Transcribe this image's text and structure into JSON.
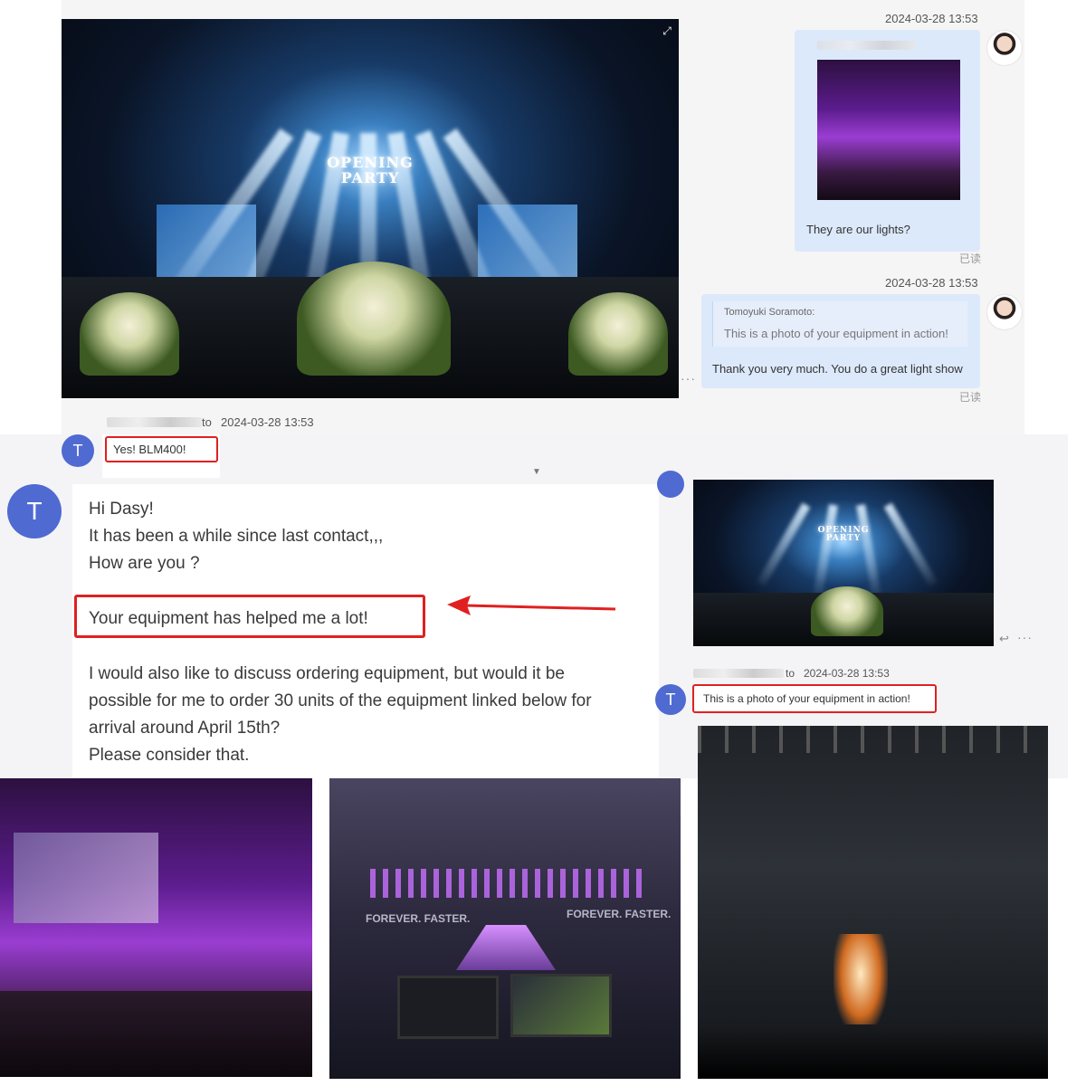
{
  "top_chat": {
    "photo_title_line1": "OPENING",
    "photo_title_line2": "PARTY",
    "msg1": {
      "time": "2024-03-28 13:53",
      "sender_blurred": "Tomoyuki Soramoto:",
      "text": "They are our lights?",
      "read_status": "已读"
    },
    "msg2": {
      "time": "2024-03-28 13:53",
      "quote_sender": "Tomoyuki Soramoto:",
      "quote_text": "This is a photo of your equipment in action!",
      "text": "Thank you very much. You do a great light show",
      "read_status": "已读"
    },
    "more_label": "···"
  },
  "reply_row": {
    "sender_suffix": "to",
    "time": "2024-03-28 13:53",
    "avatar_letter": "T",
    "text": "Yes! BLM400!"
  },
  "main_message": {
    "avatar_letter": "T",
    "greeting": "Hi Dasy!",
    "line2": "It has been a while since last contact,,,",
    "line3": "How are you ?",
    "highlight": "Your equipment has helped me a lot!",
    "para_line1": "I would also like to discuss ordering equipment, but would it be",
    "para_line2": "possible for me to order 30 units of the equipment linked below for",
    "para_line3": "arrival around April 15th?",
    "para_line4": "Please consider that."
  },
  "right_chat": {
    "avatar_letter": "T",
    "sender_suffix": "to",
    "time": "2024-03-28 13:53",
    "text": "This is a photo of your equipment in action!",
    "photo_title_line1": "OPENING",
    "photo_title_line2": "PARTY",
    "more_label": "···"
  },
  "bottom_photos": {
    "arena_banner_left": "FOREVER. FASTER.",
    "arena_banner_right": "FOREVER. FASTER."
  },
  "colors": {
    "highlight_red": "#e02020",
    "avatar_blue": "#4f6ad1",
    "bubble_blue": "#dce9fb"
  }
}
